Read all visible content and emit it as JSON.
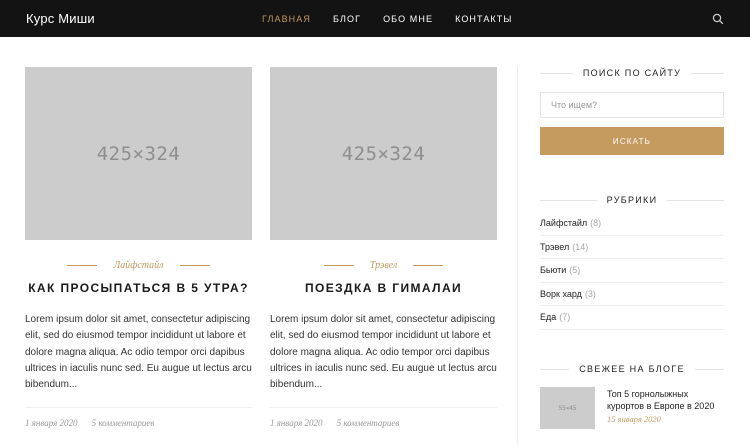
{
  "header": {
    "brand": "Курс Миши",
    "nav": [
      "Главная",
      "Блог",
      "Обо мне",
      "Контакты"
    ],
    "active_nav": 0,
    "search_icon": "search-icon"
  },
  "posts": [
    {
      "thumb": "425×324",
      "category": "Лайфстайл",
      "title": "Как просыпаться в 5 утра?",
      "excerpt": "Lorem ipsum dolor sit amet, consectetur adipiscing elit, sed do eiusmod tempor incididunt ut labore et dolore magna aliqua. Ac odio tempor orci dapibus ultrices in iaculis nunc sed. Eu augue ut lectus arcu bibendum...",
      "date": "1 января 2020",
      "comments": "5 комментариев"
    },
    {
      "thumb": "425×324",
      "category": "Трэвел",
      "title": "Поездка в Гималаи",
      "excerpt": "Lorem ipsum dolor sit amet, consectetur adipiscing elit, sed do eiusmod tempor incididunt ut labore et dolore magna aliqua. Ac odio tempor orci dapibus ultrices in iaculis nunc sed. Eu augue ut lectus arcu bibendum...",
      "date": "1 января 2020",
      "comments": "5 комментариев"
    }
  ],
  "sidebar": {
    "search": {
      "heading": "Поиск по сайту",
      "placeholder": "Что ищем?",
      "button": "Искать"
    },
    "categories": {
      "heading": "Рубрики",
      "items": [
        {
          "name": "Лайфстайл",
          "count": "(8)"
        },
        {
          "name": "Трэвел",
          "count": "(14)"
        },
        {
          "name": "Бьюти",
          "count": "(5)"
        },
        {
          "name": "Ворк хард",
          "count": "(3)"
        },
        {
          "name": "Еда",
          "count": "(7)"
        }
      ]
    },
    "recent": {
      "heading": "Свежее на блоге",
      "items": [
        {
          "thumb": "55×45",
          "title": "Топ 5 горнолыжных курортов в Европе в 2020",
          "date": "15 января 2020"
        }
      ]
    }
  },
  "colors": {
    "accent": "#c49a5f",
    "header_bg": "#131313",
    "placeholder_gray": "#cccccc"
  }
}
